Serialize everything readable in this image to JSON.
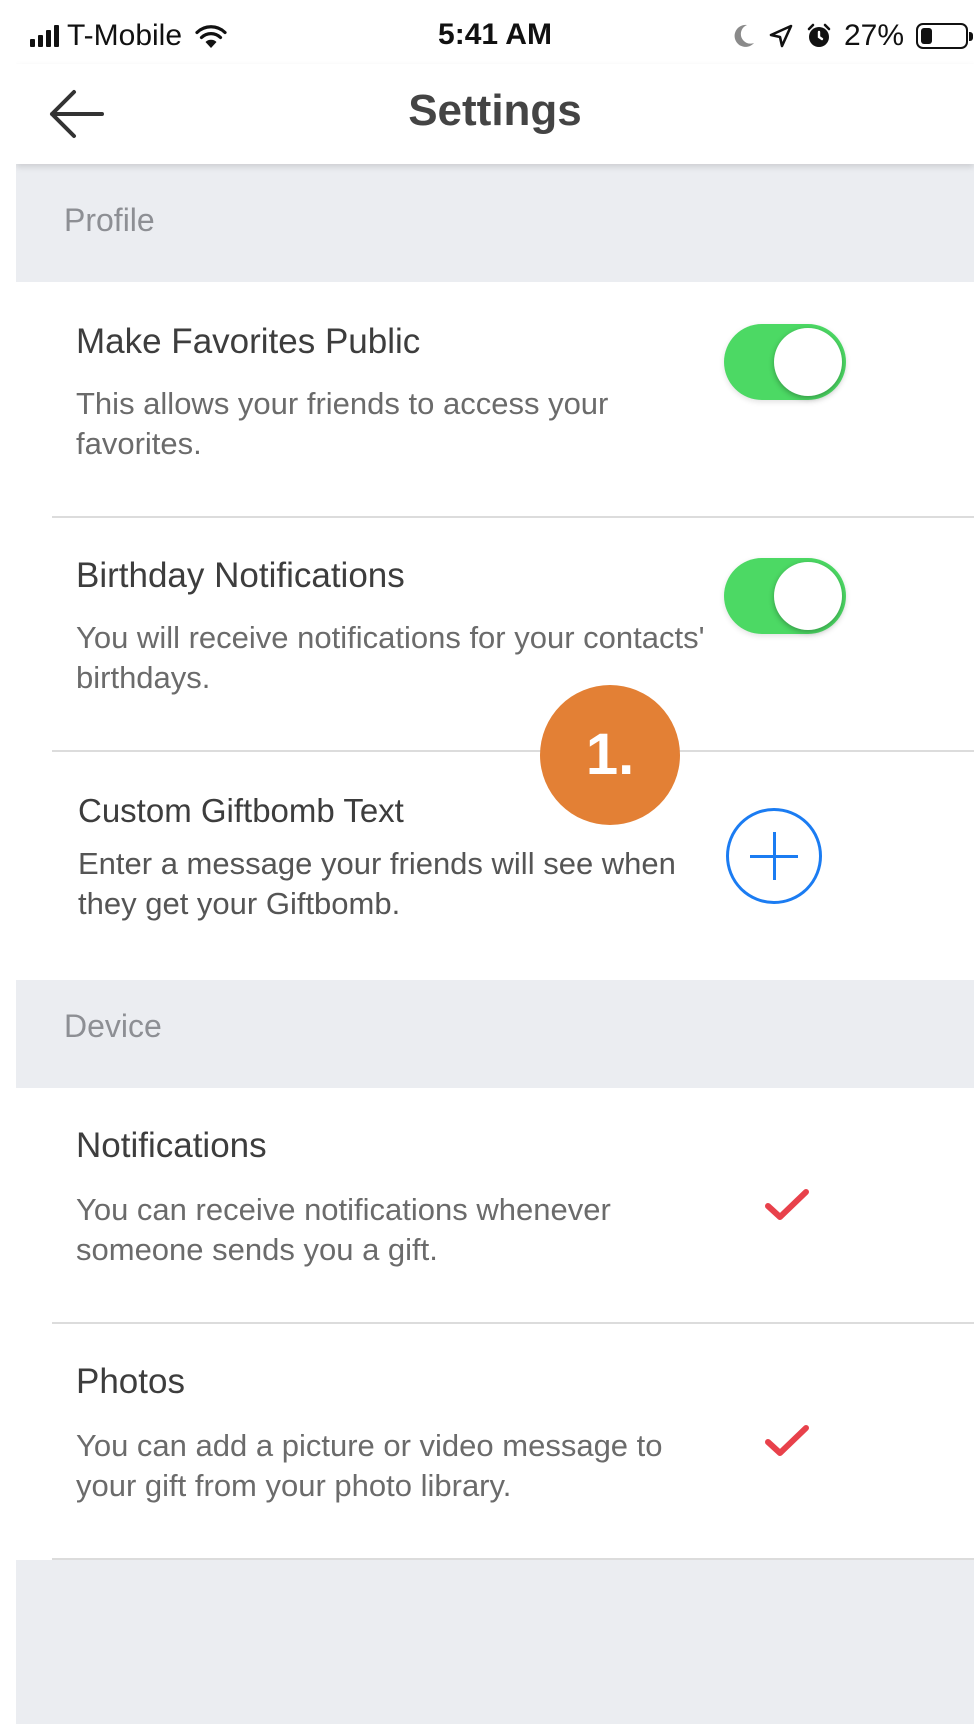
{
  "status_bar": {
    "carrier": "T-Mobile",
    "time": "5:41 AM",
    "battery_pct": "27%",
    "battery_level": 0.27,
    "icons": [
      "signal-icon",
      "wifi-icon",
      "moon-icon",
      "location-icon",
      "alarm-icon",
      "battery-icon"
    ]
  },
  "nav": {
    "title": "Settings",
    "back_icon": "arrow-left-icon"
  },
  "sections": {
    "profile": {
      "label": "Profile",
      "rows": [
        {
          "title": "Make Favorites Public",
          "desc": "This allows your friends to access your favorites.",
          "toggle_on": true
        },
        {
          "title": "Birthday Notifications",
          "desc": "You will receive notifications for your contacts' birthdays.",
          "toggle_on": true
        },
        {
          "title": "Custom Giftbomb Text",
          "desc": "Enter a message your friends will see when they get your Giftbomb.",
          "action_icon": "plus-circle-icon"
        }
      ]
    },
    "device": {
      "label": "Device",
      "rows": [
        {
          "title": "Notifications",
          "desc": "You can receive notifications whenever someone sends you a gift.",
          "status_icon": "checkmark-icon"
        },
        {
          "title": "Photos",
          "desc": "You can add a picture or video message to your gift from your photo library.",
          "status_icon": "checkmark-icon"
        }
      ]
    }
  },
  "annotation": {
    "label": "1."
  },
  "colors": {
    "toggle_on": "#4cd964",
    "accent_blue": "#1b7cf2",
    "check_red": "#e8414b",
    "section_bg": "#ebedf1",
    "badge_orange": "#e38035"
  }
}
